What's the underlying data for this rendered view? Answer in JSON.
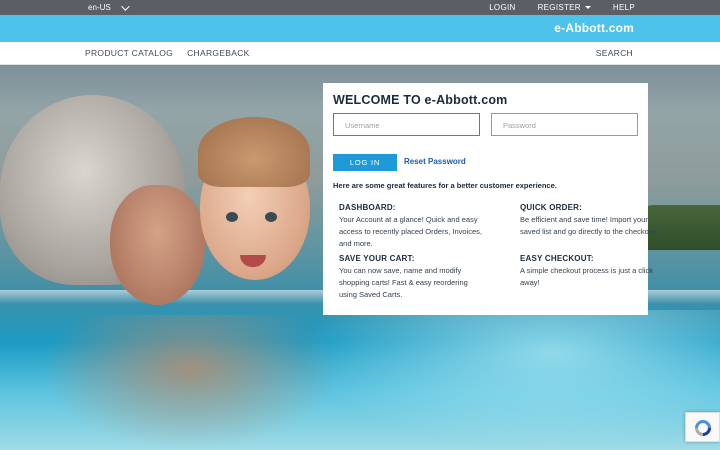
{
  "utility": {
    "locale": "en-US",
    "login": "LOGIN",
    "register": "REGISTER",
    "help": "HELP"
  },
  "brand": {
    "logo_text": "e-Abbott.com"
  },
  "nav": {
    "items": [
      {
        "label": "PRODUCT CATALOG"
      },
      {
        "label": "CHARGEBACK"
      }
    ],
    "search": "SEARCH"
  },
  "login": {
    "title": "WELCOME TO e-Abbott.com",
    "username_placeholder": "Username",
    "password_placeholder": "Password",
    "login_button": "LOG IN",
    "reset_link": "Reset Password",
    "intro": "Here are some great features for a better customer experience.",
    "features": [
      {
        "title": "DASHBOARD:",
        "text": "Your Account at a glance! Quick and easy access to recently placed Orders, Invoices, and more."
      },
      {
        "title": "QUICK ORDER:",
        "text": "Be efficient and save time! Import your saved list and go directly to the checkout."
      },
      {
        "title": "SAVE YOUR CART:",
        "text": "You can now save, name and modify shopping carts! Fast & easy reordering using Saved Carts."
      },
      {
        "title": "EASY CHECKOUT:",
        "text": "A simple checkout process is just a click away!"
      }
    ]
  },
  "colors": {
    "utility_bar": "#5a5f66",
    "brand_bar": "#4dc3ec",
    "login_button": "#1e9ad9",
    "link": "#1d5ca8"
  },
  "icons": {
    "locale_toggle": "chevron-down-icon",
    "register_toggle": "caret-down-icon",
    "recaptcha": "recaptcha-icon"
  }
}
